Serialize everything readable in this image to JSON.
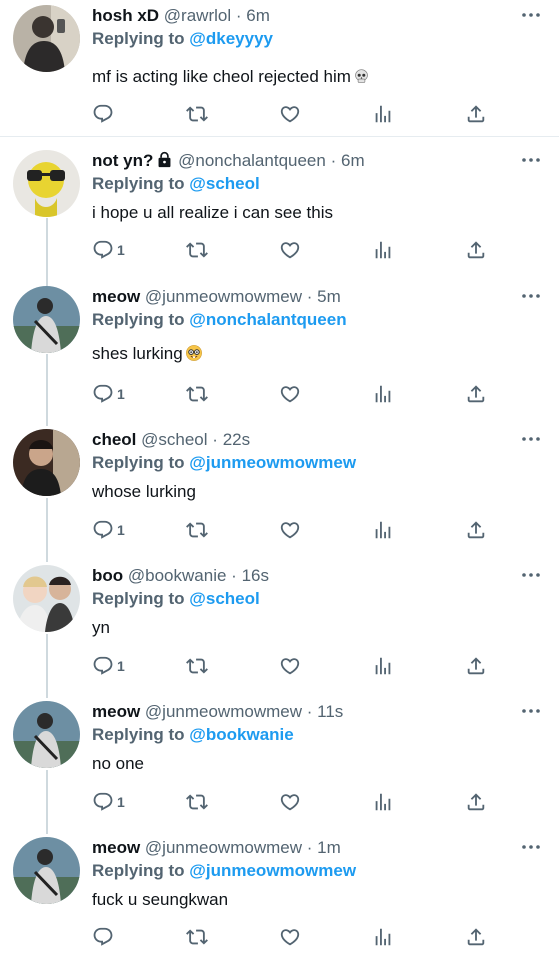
{
  "colors": {
    "mention": "#1d9bf0",
    "secondary": "#536471",
    "text": "#0f1419"
  },
  "tweets": [
    {
      "name": "hosh xD",
      "handle": "@rawrlol",
      "dot": "·",
      "time": "6m",
      "replying_label": "Replying to",
      "replying_to": "@dkeyyyy",
      "text": "mf is acting like cheol rejected him",
      "emoji": "skull-emoji",
      "reply_count": "",
      "locked": false
    },
    {
      "name": "not yn?",
      "handle": "@nonchalantqueen",
      "dot": "·",
      "time": "6m",
      "replying_label": "Replying to",
      "replying_to": "@scheol",
      "text": "i hope u all realize i can see this",
      "emoji": "",
      "reply_count": "1",
      "locked": true
    },
    {
      "name": "meow",
      "handle": "@junmeowmowmew",
      "dot": "·",
      "time": "5m",
      "replying_label": "Replying to",
      "replying_to": "@nonchalantqueen",
      "text": "shes lurking",
      "emoji": "nerd-face-emoji",
      "reply_count": "1",
      "locked": false
    },
    {
      "name": "cheol",
      "handle": "@scheol",
      "dot": "·",
      "time": "22s",
      "replying_label": "Replying to",
      "replying_to": "@junmeowmowmew",
      "text": "whose lurking",
      "emoji": "",
      "reply_count": "1",
      "locked": false
    },
    {
      "name": "boo",
      "handle": "@bookwanie",
      "dot": "·",
      "time": "16s",
      "replying_label": "Replying to",
      "replying_to": "@scheol",
      "text": "yn",
      "emoji": "",
      "reply_count": "1",
      "locked": false
    },
    {
      "name": "meow",
      "handle": "@junmeowmowmew",
      "dot": "·",
      "time": "11s",
      "replying_label": "Replying to",
      "replying_to": "@bookwanie",
      "text": "no one",
      "emoji": "",
      "reply_count": "1",
      "locked": false
    },
    {
      "name": "meow",
      "handle": "@junmeowmowmew",
      "dot": "·",
      "time": "1m",
      "replying_label": "Replying to",
      "replying_to": "@junmeowmowmew",
      "text": "fuck u seungkwan",
      "emoji": "",
      "reply_count": "",
      "locked": false
    }
  ]
}
